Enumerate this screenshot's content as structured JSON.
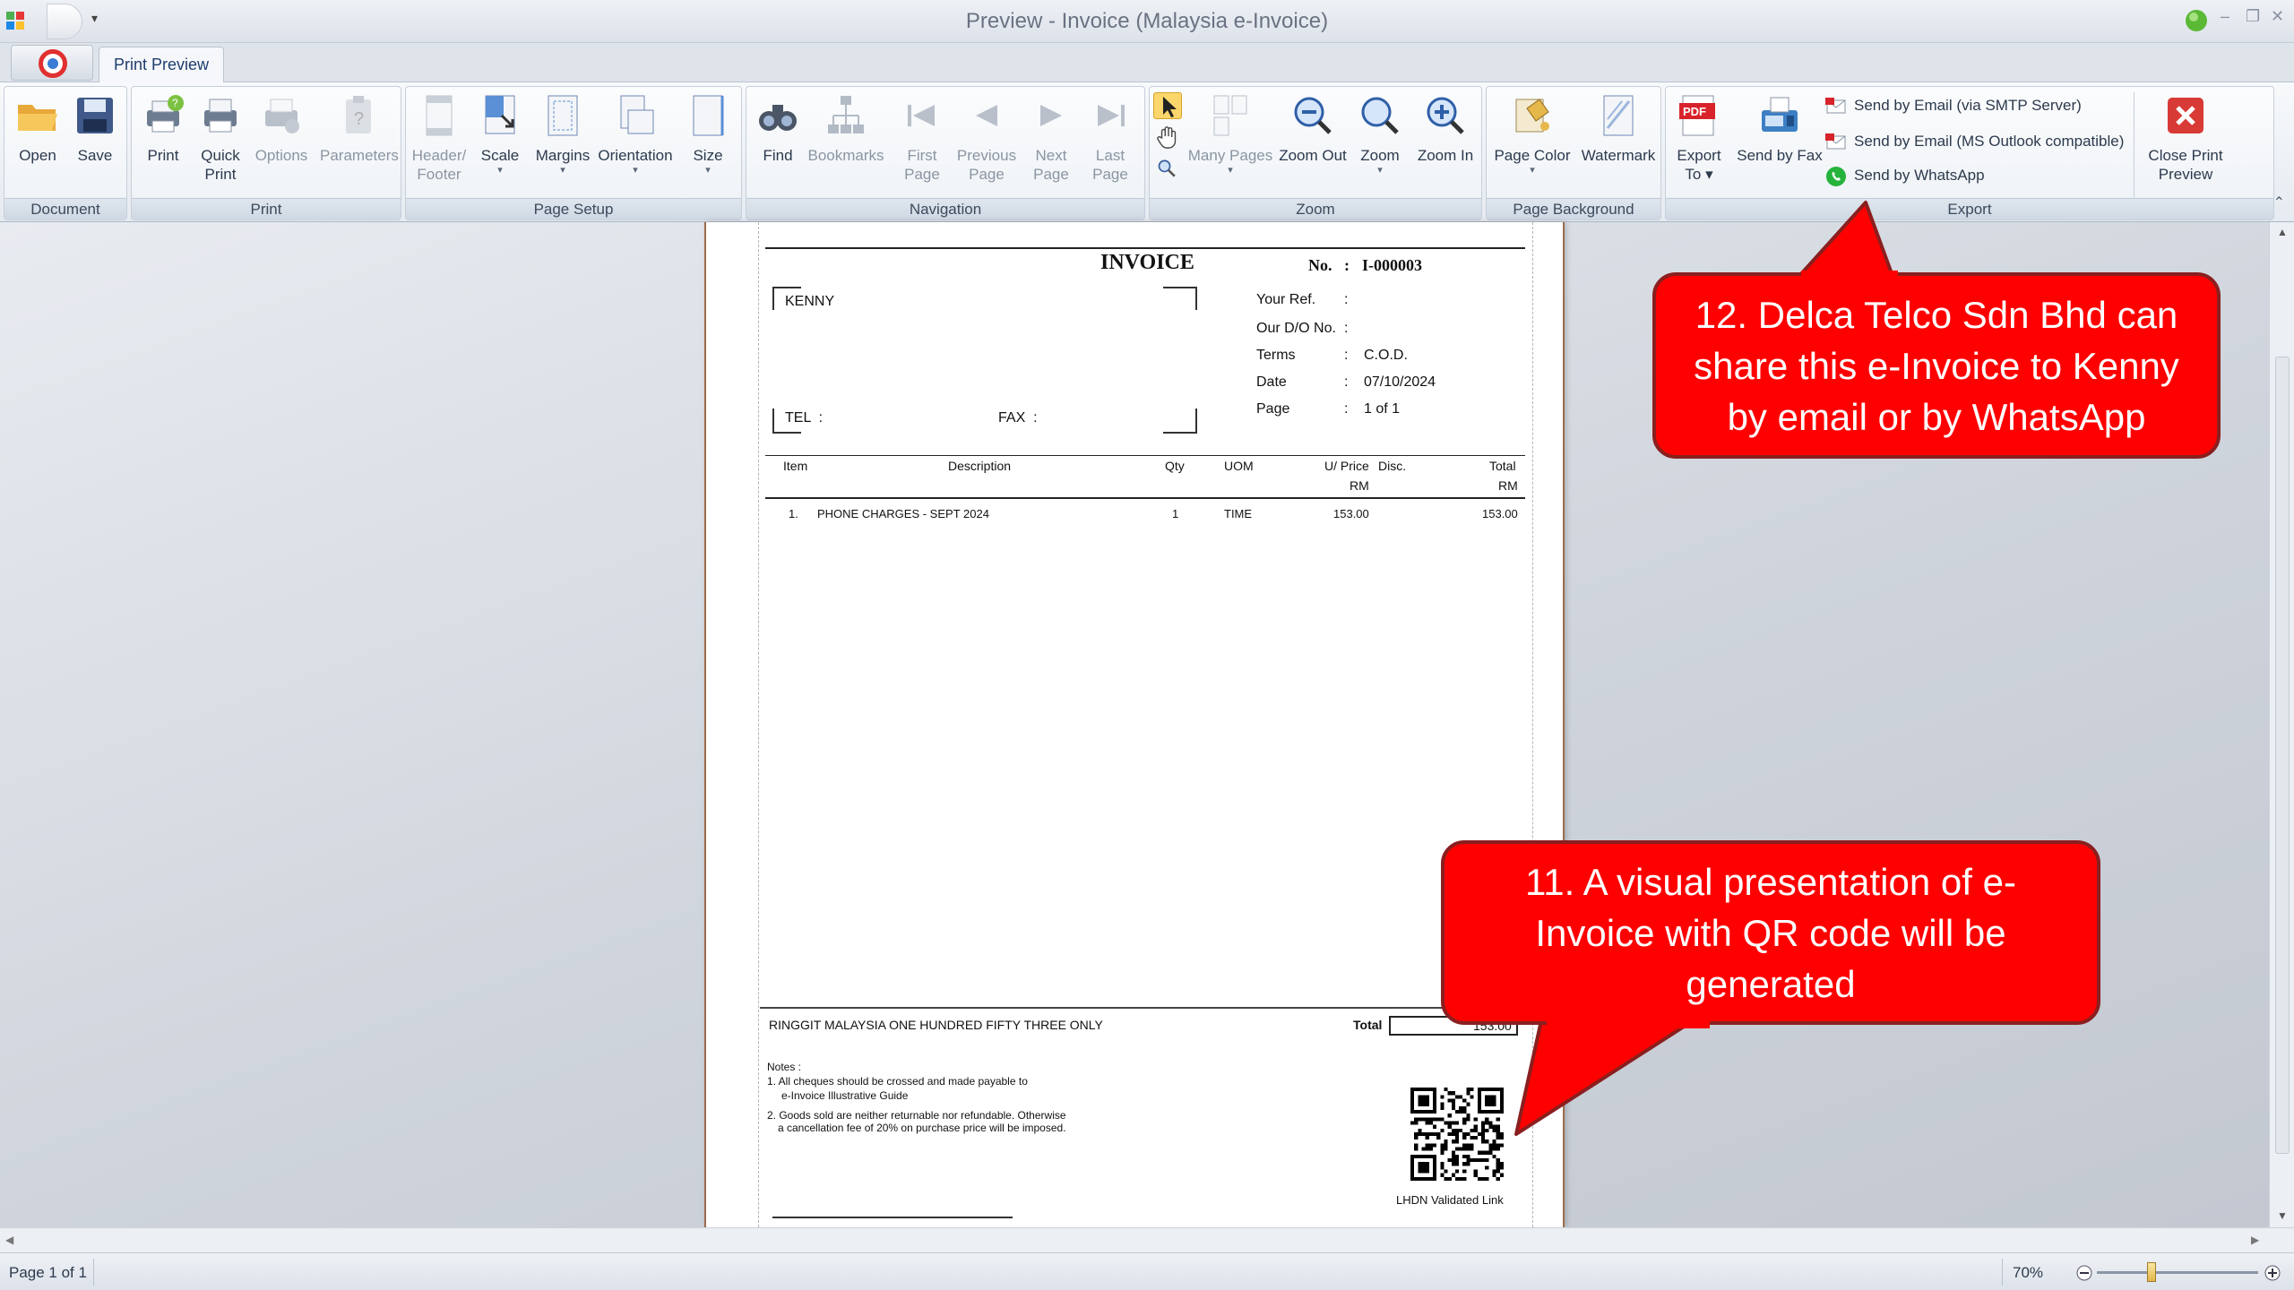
{
  "window": {
    "title": "Preview - Invoice (Malaysia e-Invoice)",
    "tab_label": "Print Preview"
  },
  "ribbon": {
    "document": {
      "label": "Document",
      "open": "Open",
      "save": "Save"
    },
    "print": {
      "label": "Print",
      "print": "Print",
      "quick_print_1": "Quick",
      "quick_print_2": "Print",
      "options": "Options",
      "parameters": "Parameters"
    },
    "page_setup": {
      "label": "Page Setup",
      "header_1": "Header/",
      "header_2": "Footer",
      "scale": "Scale",
      "margins": "Margins",
      "orientation": "Orientation",
      "size": "Size"
    },
    "navigation": {
      "label": "Navigation",
      "find": "Find",
      "bookmarks": "Bookmarks",
      "first_1": "First",
      "first_2": "Page",
      "prev_1": "Previous",
      "prev_2": "Page",
      "next_1": "Next",
      "next_2": "Page",
      "last_1": "Last",
      "last_2": "Page"
    },
    "zoom": {
      "label": "Zoom",
      "many_pages": "Many Pages",
      "zoom_out": "Zoom Out",
      "zoom": "Zoom",
      "zoom_in": "Zoom In"
    },
    "page_background": {
      "label": "Page Background",
      "page_color": "Page Color",
      "watermark": "Watermark"
    },
    "export": {
      "label": "Export",
      "export_1": "Export",
      "export_2": "To",
      "send_fax": "Send by Fax",
      "email_smtp": "Send by Email (via SMTP Server)",
      "email_outlook": "Send by Email (MS Outlook compatible)",
      "whatsapp": "Send by WhatsApp",
      "close_1": "Close Print",
      "close_2": "Preview"
    }
  },
  "invoice": {
    "heading": "INVOICE",
    "no_label": "No.",
    "no_colon": ":",
    "no_value": "I-000003",
    "customer": "KENNY",
    "tel_label": "TEL  :",
    "fax_label": "FAX  :",
    "fields": [
      {
        "label": "Your Ref.",
        "colon": ":",
        "value": ""
      },
      {
        "label": "Our D/O No.",
        "colon": ":",
        "value": ""
      },
      {
        "label": "Terms",
        "colon": ":",
        "value": "C.O.D."
      },
      {
        "label": "Date",
        "colon": ":",
        "value": "07/10/2024"
      },
      {
        "label": "Page",
        "colon": ":",
        "value": "1 of 1"
      }
    ],
    "columns": {
      "item": "Item",
      "description": "Description",
      "qty": "Qty",
      "uom": "UOM",
      "uprice": "U/ Price",
      "uprice_unit": "RM",
      "disc": "Disc.",
      "total": "Total",
      "total_unit": "RM"
    },
    "rows": [
      {
        "item": "1.",
        "description": "PHONE CHARGES - SEPT 2024",
        "qty": "1",
        "uom": "TIME",
        "uprice": "153.00",
        "disc": "",
        "total": "153.00"
      }
    ],
    "amount_words": "RINGGIT MALAYSIA ONE HUNDRED FIFTY THREE ONLY",
    "total_label": "Total",
    "total_value": "153.00",
    "notes_title": "Notes :",
    "note1a": "1. All cheques should be crossed and made payable to",
    "note1b": "e-Invoice Illustrative Guide",
    "note2a": "2. Goods sold are neither returnable nor refundable. Otherwise",
    "note2b": "a cancellation fee of 20% on purchase price will be imposed.",
    "qr_caption": "LHDN Validated Link"
  },
  "callouts": {
    "c12": "12. Delca Telco Sdn Bhd can share this e-Invoice to Kenny by email or by WhatsApp",
    "c11": "11. A visual presentation of e-Invoice with QR code will be generated"
  },
  "status": {
    "page": "Page 1 of 1",
    "zoom": "70%"
  },
  "colors": {
    "callout": "#ff0000",
    "callout_border": "#8a1f1f",
    "paper_edge": "#9b6d4b"
  }
}
